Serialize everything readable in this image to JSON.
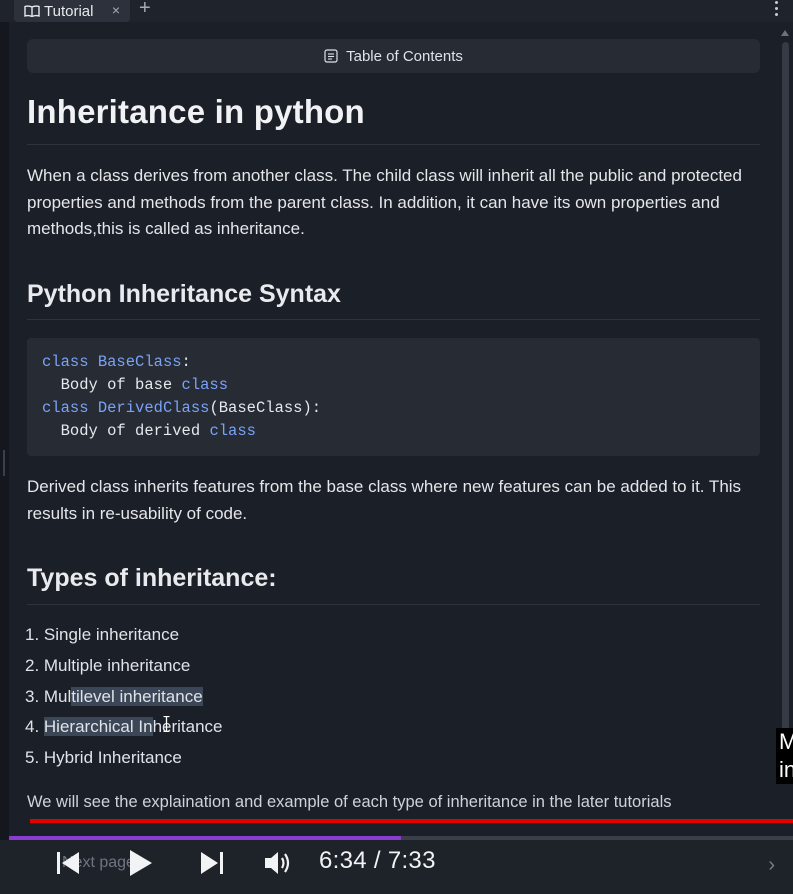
{
  "tabbar": {
    "tab_label": "Tutorial",
    "close_glyph": "×",
    "new_tab_glyph": "+"
  },
  "toc": {
    "label": "Table of Contents"
  },
  "article": {
    "title": "Inheritance in python",
    "intro": "When a class derives from another class. The child class will inherit all the public and protected properties and methods from the parent class. In addition, it can have its own properties and methods,this is called as inheritance.",
    "syntax_heading": "Python Inheritance Syntax",
    "code_lines": [
      [
        "class",
        " ",
        "BaseClass",
        ":"
      ],
      [
        "  Body of base ",
        "class"
      ],
      [
        "class",
        " ",
        "DerivedClass",
        "(BaseClass):"
      ],
      [
        "  Body of derived ",
        "class"
      ]
    ],
    "derived_para": "Derived class inherits features from the base class where new features can be added to it. This results in re-usability of code.",
    "types_heading": "Types of inheritance:",
    "types": [
      "1. Single inheritance",
      "2. Multiple inheritance",
      "3. Multilevel inheritance",
      "4. Hierarchical Inheritance",
      "5. Hybrid Inheritance"
    ],
    "closing": "We will see the explaination and example of each type of inheritance in the later tutorials"
  },
  "caption_overlay": "M in",
  "player": {
    "time": "6:34 / 7:33",
    "progress": 0.5,
    "next_page_label": "Next page"
  },
  "colors": {
    "background": "#1b1f27",
    "keyword": "#7aa2f7",
    "progress": "#8a3bd1",
    "red_line": "#e10000"
  }
}
